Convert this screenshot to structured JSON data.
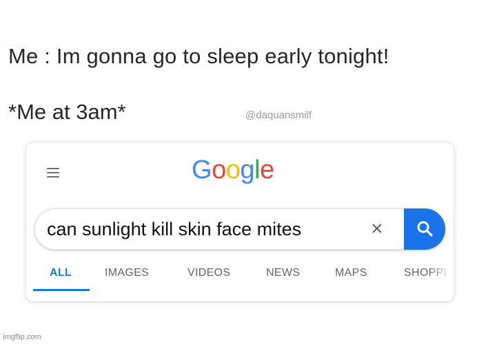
{
  "caption": {
    "line1": "Me : Im gonna go to sleep early tonight!",
    "line2": "*Me at 3am*",
    "watermark": "@daquansmilf"
  },
  "google": {
    "logo_letters": [
      "G",
      "o",
      "o",
      "g",
      "l",
      "e"
    ],
    "logo_colors": [
      "#4285F4",
      "#EA4335",
      "#FBBC05",
      "#4285F4",
      "#34A853",
      "#EA4335"
    ],
    "search": {
      "value": "can sunlight kill skin face mites",
      "clear_icon": "close-icon",
      "search_icon": "search-icon"
    },
    "tabs": [
      {
        "label": "ALL",
        "active": true
      },
      {
        "label": "IMAGES",
        "active": false
      },
      {
        "label": "VIDEOS",
        "active": false
      },
      {
        "label": "NEWS",
        "active": false
      },
      {
        "label": "MAPS",
        "active": false
      },
      {
        "label": "SHOPPI",
        "active": false
      }
    ],
    "accent_color": "#1a73e8",
    "menu_icon": "hamburger-menu-icon"
  },
  "footer": {
    "site": "imgflip.com"
  }
}
